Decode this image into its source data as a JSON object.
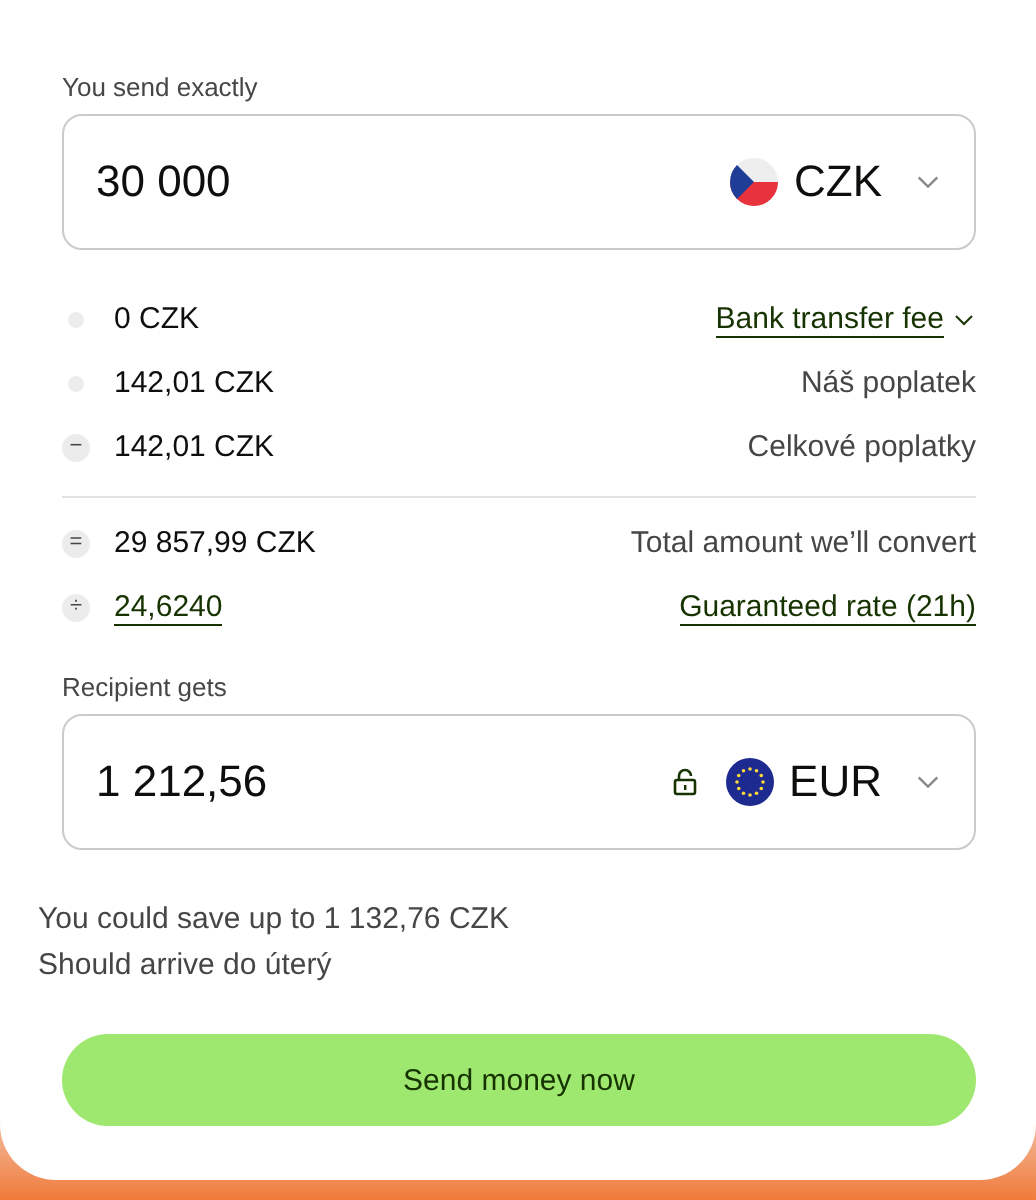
{
  "send": {
    "label": "You send exactly",
    "value": "30 000",
    "currency": "CZK",
    "flag": {
      "kind": "cz"
    }
  },
  "fee_groups": [
    {
      "rows": [
        {
          "kind": "dropdown",
          "marker": {
            "kind": "dot"
          },
          "amount": "0 CZK",
          "amount_link": false,
          "label": "Bank transfer fee"
        },
        {
          "kind": "plain",
          "marker": {
            "kind": "dot"
          },
          "amount": "142,01 CZK",
          "amount_link": false,
          "label": "Náš poplatek"
        },
        {
          "kind": "plain",
          "marker": {
            "kind": "symbol",
            "symbol": "−"
          },
          "amount": "142,01 CZK",
          "amount_link": false,
          "label": "Celkové poplatky"
        }
      ]
    },
    {
      "rows": [
        {
          "kind": "plain",
          "marker": {
            "kind": "symbol",
            "symbol": "="
          },
          "amount": "29 857,99 CZK",
          "amount_link": false,
          "label": "Total amount we’ll convert"
        },
        {
          "kind": "link",
          "marker": {
            "kind": "symbol",
            "symbol": "÷"
          },
          "amount": "24,6240",
          "amount_link": true,
          "label": "Guaranteed rate (21h)"
        }
      ]
    }
  ],
  "receive": {
    "label": "Recipient gets",
    "value": "1 212,56",
    "currency": "EUR",
    "flag": {
      "kind": "eu"
    },
    "locked": false
  },
  "notes": [
    "You could save up to 1 132,76 CZK",
    "Should arrive do úterý"
  ],
  "button": "Send money now"
}
